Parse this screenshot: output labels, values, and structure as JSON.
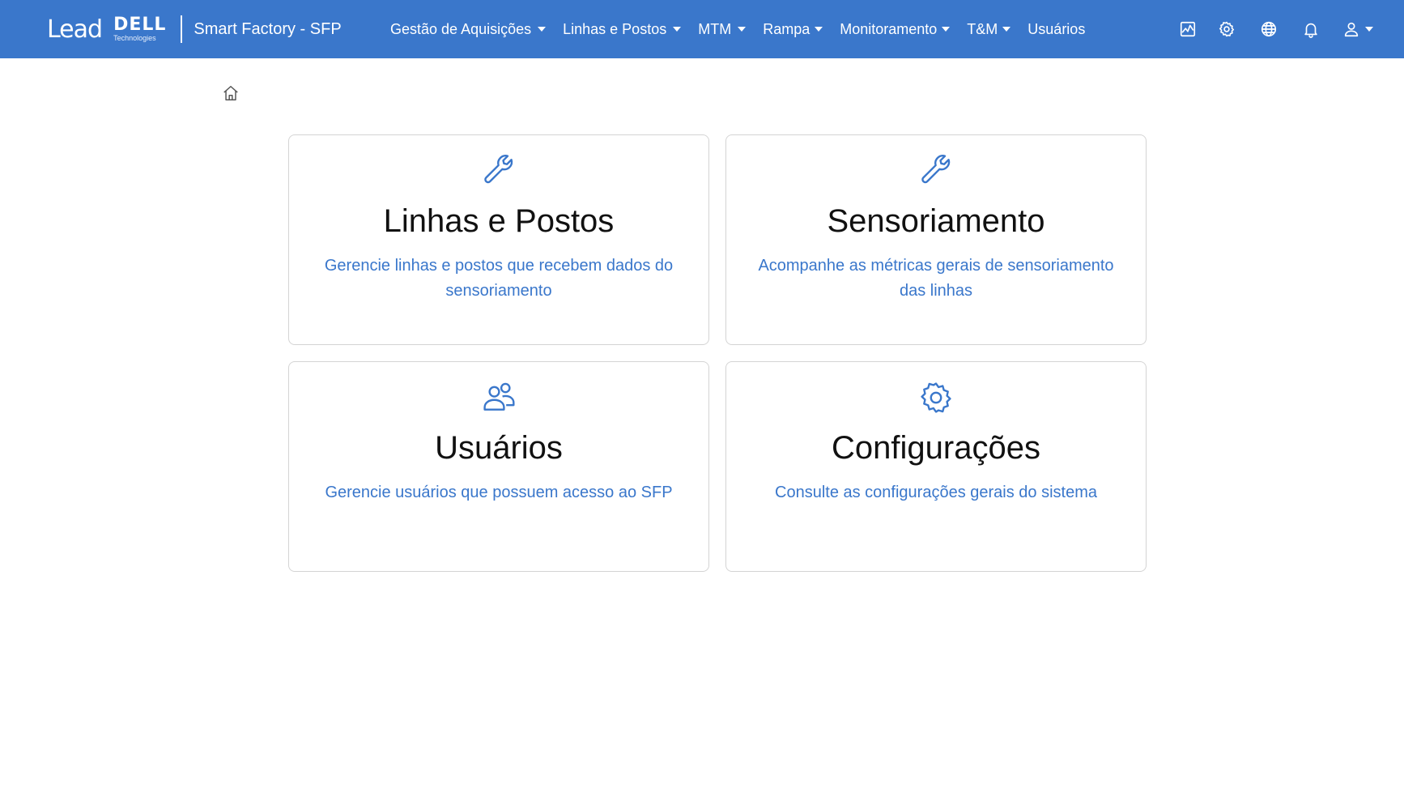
{
  "header": {
    "logo_lead": "Lead",
    "logo_dell": "DELL",
    "logo_dell_sub": "Technologies",
    "app_title": "Smart Factory - SFP",
    "background_color": "#3a77cb"
  },
  "nav": {
    "items": [
      {
        "label": "Gestão de Aquisições",
        "dropdown": true
      },
      {
        "label": "Linhas e Postos",
        "dropdown": true
      },
      {
        "label": "MTM",
        "dropdown": true
      },
      {
        "label": "Rampa",
        "dropdown": true
      },
      {
        "label": "Monitoramento",
        "dropdown": true
      },
      {
        "label": "T&M",
        "dropdown": true
      },
      {
        "label": "Usuários",
        "dropdown": false
      }
    ]
  },
  "toolbar_icons": [
    "activity-chart-icon",
    "gear-icon",
    "globe-icon",
    "bell-icon",
    "user-icon"
  ],
  "breadcrumb": {
    "icon": "home-icon"
  },
  "cards": [
    {
      "icon": "wrench-icon",
      "title": "Linhas e Postos",
      "description": "Gerencie linhas e postos que recebem dados do sensoriamento"
    },
    {
      "icon": "wrench-icon",
      "title": "Sensoriamento",
      "description": "Acompanhe as métricas gerais de sensoriamento das linhas"
    },
    {
      "icon": "users-icon",
      "title": "Usuários",
      "description": "Gerencie usuários que possuem acesso ao SFP"
    },
    {
      "icon": "gear-icon",
      "title": "Configurações",
      "description": "Consulte as configurações gerais do sistema"
    }
  ],
  "accent_color": "#3a77cb"
}
